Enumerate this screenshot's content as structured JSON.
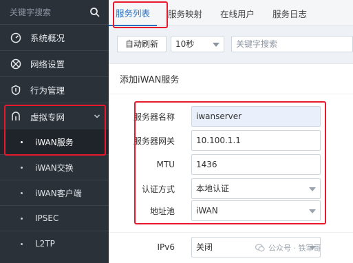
{
  "sidebar": {
    "search_placeholder": "关键字搜索",
    "items": [
      {
        "label": "系统概况",
        "icon": "gauge-icon"
      },
      {
        "label": "网络设置",
        "icon": "network-icon"
      },
      {
        "label": "行为管理",
        "icon": "shield-icon"
      },
      {
        "label": "虚拟专网",
        "icon": "tunnel-icon"
      }
    ],
    "subitems": [
      {
        "label": "iWAN服务",
        "active": true
      },
      {
        "label": "iWAN交换",
        "active": false
      },
      {
        "label": "iWAN客户端",
        "active": false
      },
      {
        "label": "IPSEC",
        "active": false
      },
      {
        "label": "L2TP",
        "active": false
      }
    ]
  },
  "tabs": [
    {
      "label": "服务列表",
      "active": true
    },
    {
      "label": "服务映射",
      "active": false
    },
    {
      "label": "在线用户",
      "active": false
    },
    {
      "label": "服务日志",
      "active": false
    }
  ],
  "toolbar": {
    "auto_refresh_label": "自动刷新",
    "interval_value": "10秒",
    "search_placeholder": "关键字搜索"
  },
  "dialog": {
    "title": "添加iWAN服务",
    "fields": [
      {
        "label": "服务器名称",
        "value": "iwanserver",
        "type": "text"
      },
      {
        "label": "服务器网关",
        "value": "10.100.1.1",
        "type": "text"
      },
      {
        "label": "MTU",
        "value": "1436",
        "type": "text"
      },
      {
        "label": "认证方式",
        "value": "本地认证",
        "type": "select"
      },
      {
        "label": "地址池",
        "value": "iWAN",
        "type": "select"
      },
      {
        "label": "IPv6",
        "value": "关闭",
        "type": "select"
      }
    ]
  },
  "watermark": {
    "text": "公众号 · 铁军哥"
  },
  "colors": {
    "highlight": "#e8192c",
    "accent": "#2a6fbd",
    "sidebar_bg": "#2b3139"
  }
}
